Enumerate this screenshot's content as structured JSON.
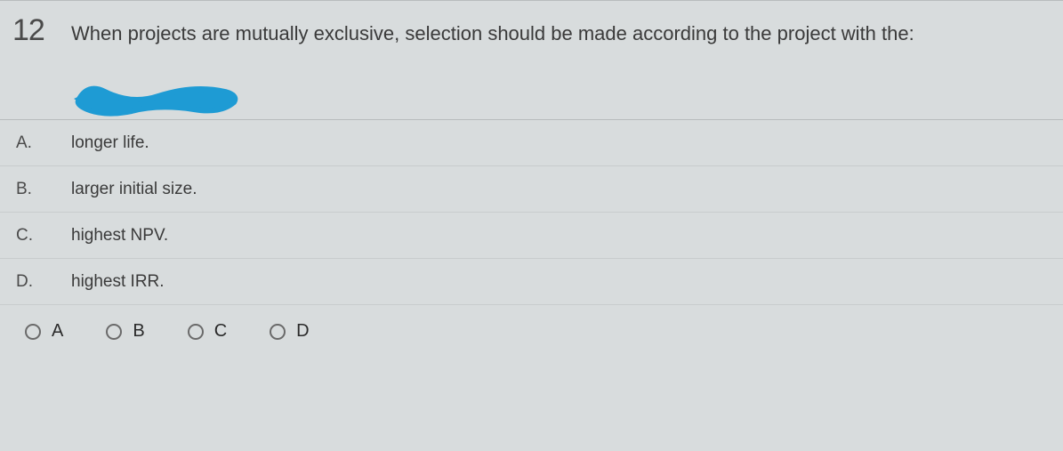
{
  "question": {
    "number": "12",
    "text": "When projects are mutually exclusive, selection should be made according to the project with the:"
  },
  "options": [
    {
      "letter": "A.",
      "text": "longer life."
    },
    {
      "letter": "B.",
      "text": "larger initial size."
    },
    {
      "letter": "C.",
      "text": "highest NPV."
    },
    {
      "letter": "D.",
      "text": "highest IRR."
    }
  ],
  "answers": [
    {
      "label": "A"
    },
    {
      "label": "B"
    },
    {
      "label": "C"
    },
    {
      "label": "D"
    }
  ]
}
